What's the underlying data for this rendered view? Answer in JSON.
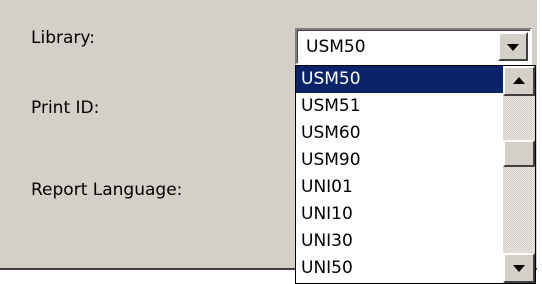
{
  "form": {
    "library_label": "Library:",
    "print_id_label": "Print ID:",
    "report_language_label": "Report Language:"
  },
  "combo": {
    "value": "USM50",
    "button_icon": "chevron-down-icon"
  },
  "dropdown": {
    "items": [
      "USM50",
      "USM51",
      "USM60",
      "USM90",
      "UNI01",
      "UNI10",
      "UNI30",
      "UNI50"
    ],
    "selected_index": 0
  },
  "scrollbar": {
    "up_icon": "arrow-up-icon",
    "down_icon": "arrow-down-icon"
  },
  "colors": {
    "panel_bg": "#d4d0c8",
    "selection_bg": "#0a246a",
    "selection_text": "#ffffff"
  }
}
